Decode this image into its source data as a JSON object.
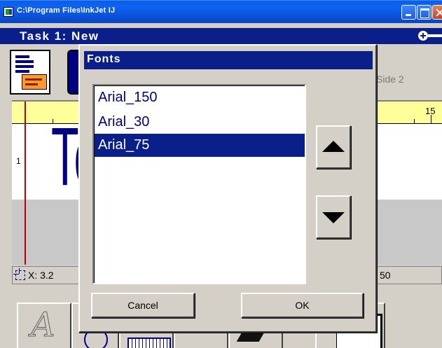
{
  "window": {
    "title": "C:\\Program Files\\InkJet   IJ",
    "controls": [
      "minimize-icon",
      "maximize-icon",
      "close-icon"
    ]
  },
  "task": {
    "title": "Task 1: New",
    "toggle_icon": "plus-minus-toggle-icon"
  },
  "toolbar": {
    "side_label": "Side 2",
    "icons": [
      "document-icon",
      "document-icon-2"
    ]
  },
  "editor": {
    "ruler_number": "15",
    "line_number": "1",
    "preview_text": "Te",
    "text_color": "#000080",
    "ruler_color": "#ffff99"
  },
  "status": {
    "coords": "X: 3.2",
    "right_value": "50",
    "icon": "crosshair-icon"
  },
  "bottom_tools": {
    "font_tool_glyph": "A",
    "icons": [
      "font-tool-icon",
      "circle-tool-icon",
      "grid-tool-icon",
      "blank-tool-icon",
      "brush-tool-icon",
      "page-tool-icon"
    ]
  },
  "dialog": {
    "title": "Fonts",
    "fonts": [
      "Arial_150",
      "Arial_30",
      "Arial_75"
    ],
    "selected_font": "Arial_75",
    "buttons": {
      "cancel": "Cancel",
      "ok": "OK"
    },
    "scroll_icons": [
      "arrow-up-icon",
      "arrow-down-icon"
    ],
    "accent_color": "#0a1f8a"
  }
}
